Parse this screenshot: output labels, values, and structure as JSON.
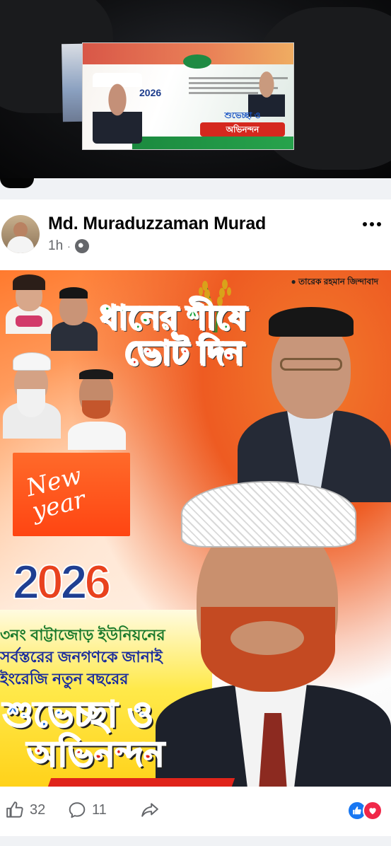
{
  "top_photo": {
    "banner_year": "2026",
    "banner_greeting_line1": "শুভেচ্ছা ও",
    "banner_greeting_line2": "অভিনন্দন"
  },
  "post": {
    "author": "Md. Muraduzzaman Murad",
    "time": "1h",
    "separator": "·",
    "more_icon": "more-horizontal-icon",
    "privacy_icon": "globe-icon"
  },
  "poster": {
    "tagline": "তারেক রহমান জিন্দাবাদ",
    "slogan_line1": "ধানের শীষে",
    "slogan_line2": "ভোট দিন",
    "new_year_text": "New year",
    "year_digits": [
      "2",
      "0",
      "2",
      "6"
    ],
    "greeting_lines": [
      "৩নং বাট্টাজোড় ইউনিয়নের",
      "সর্বস্তরের জনগণকে জানাই",
      "ইংরেজি নতুন বছরের"
    ],
    "big_greeting_line1": "শুভেচ্ছা ও",
    "big_greeting_line2": "অভিনন্দন"
  },
  "actions": {
    "like_count": "32",
    "comment_count": "11",
    "like_icon": "thumbs-up-icon",
    "comment_icon": "comment-icon",
    "share_icon": "share-icon",
    "reactions": [
      "like",
      "love"
    ]
  },
  "colors": {
    "facebook_blue": "#1877f2",
    "love_red": "#f02849",
    "secondary_text": "#65676b",
    "bnp_green": "#16a03c",
    "bnp_red": "#e0201a"
  }
}
